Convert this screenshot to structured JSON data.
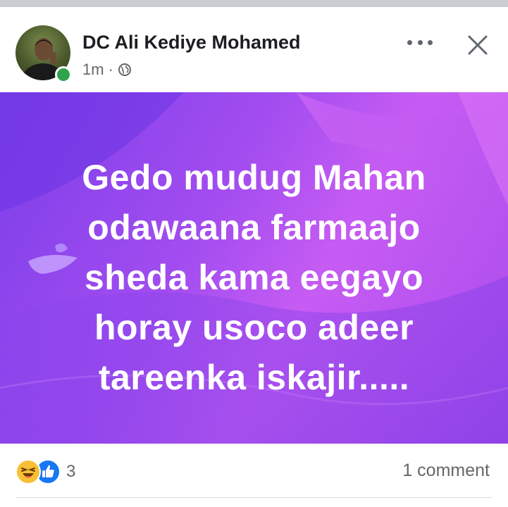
{
  "post": {
    "author": "DC Ali Kediye Mohamed",
    "time": "1m",
    "separator": "·",
    "audience_icon": "globe-icon",
    "lines": [
      "Gedo mudug Mahan",
      "odawaana farmaajo",
      "sheda kama eegayo",
      "horay usoco adeer",
      "tareenka  iskajir....."
    ],
    "background_colors": [
      "#7b3fe8",
      "#c65cf3"
    ],
    "text_color": "#ffffff"
  },
  "header": {
    "more_icon": "more-options-icon",
    "close_icon": "close-icon"
  },
  "footer": {
    "reactions": [
      "haha-reaction-icon",
      "like-reaction-icon"
    ],
    "reaction_count": "3",
    "comments": "1 comment"
  },
  "status": {
    "online_color": "#31a24c"
  }
}
